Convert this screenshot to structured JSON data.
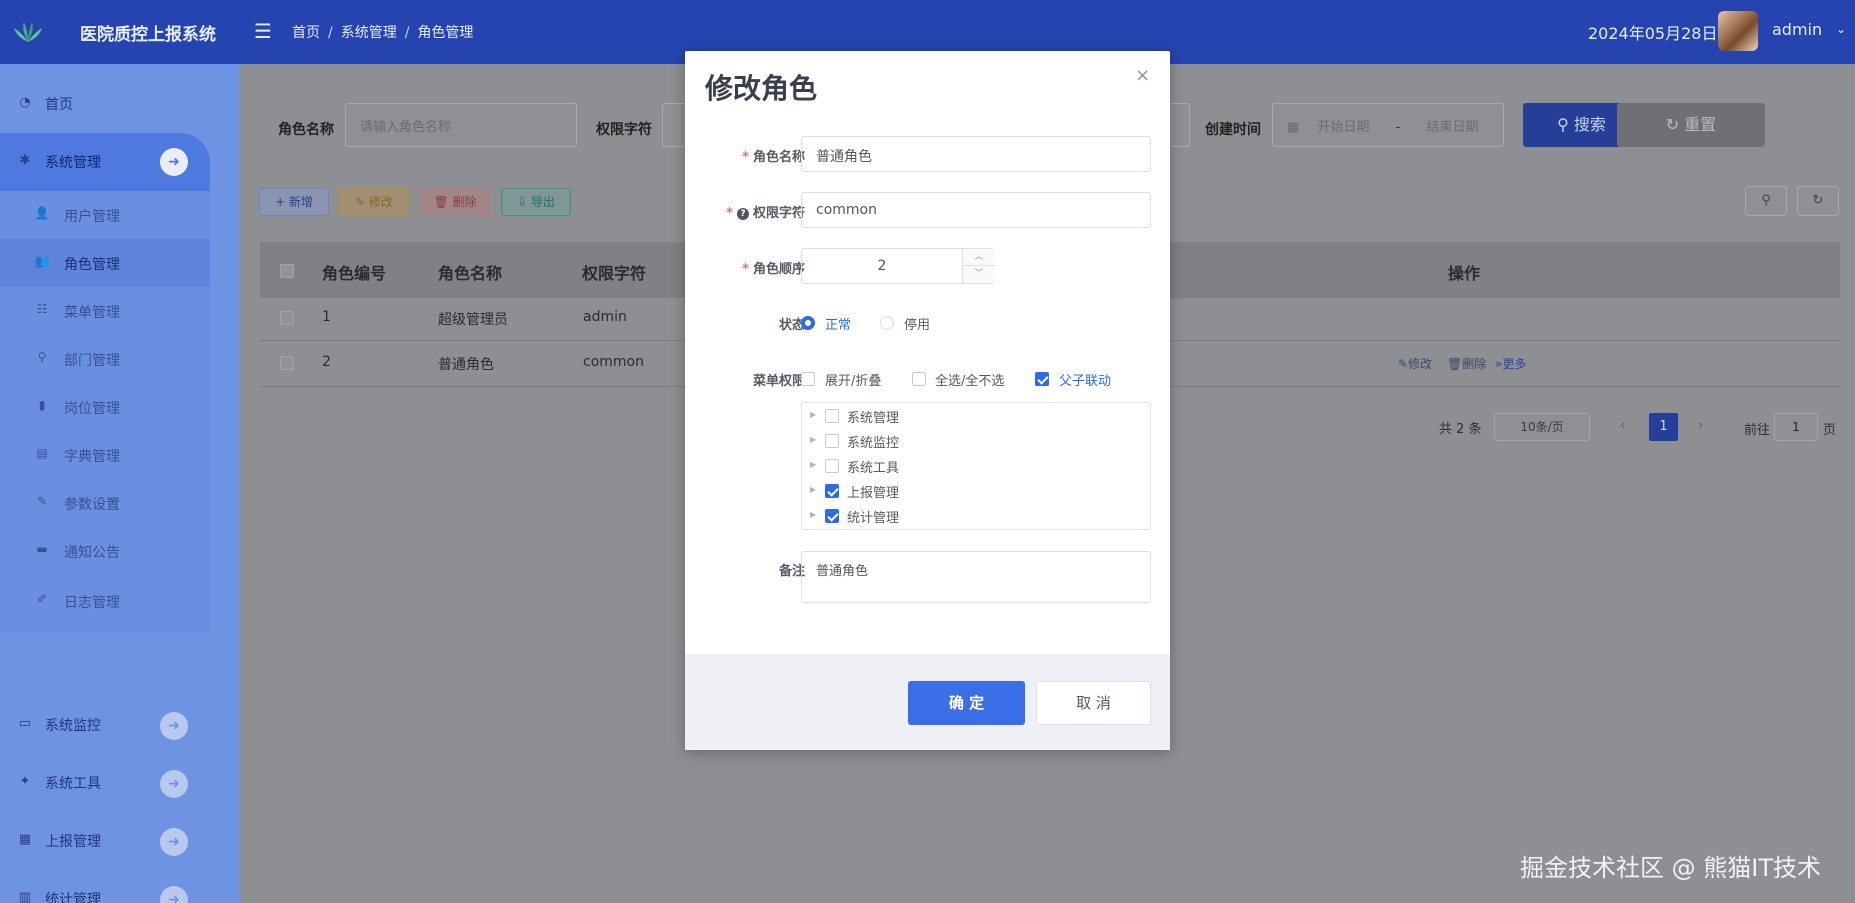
{
  "header": {
    "app_title": "医院质控上报系统",
    "breadcrumb": [
      "首页",
      "系统管理",
      "角色管理"
    ],
    "date": "2024年05月28日",
    "username": "admin"
  },
  "sidebar": {
    "items": [
      {
        "label": "首页"
      },
      {
        "label": "系统管理"
      },
      {
        "label": "系统监控"
      },
      {
        "label": "系统工具"
      },
      {
        "label": "上报管理"
      },
      {
        "label": "统计管理"
      }
    ],
    "submenu": [
      {
        "label": "用户管理"
      },
      {
        "label": "角色管理"
      },
      {
        "label": "菜单管理"
      },
      {
        "label": "部门管理"
      },
      {
        "label": "岗位管理"
      },
      {
        "label": "字典管理"
      },
      {
        "label": "参数设置"
      },
      {
        "label": "通知公告"
      },
      {
        "label": "日志管理"
      }
    ]
  },
  "search": {
    "role_name_label": "角色名称",
    "role_name_placeholder": "请输入角色名称",
    "perm_label": "权限字符",
    "created_label": "创建时间",
    "date_start": "开始日期",
    "date_sep": "-",
    "date_end": "结束日期",
    "search_btn": "搜索",
    "reset_btn": "重置"
  },
  "toolbar": {
    "add": "+ 新增",
    "edit": "✎ 修改",
    "delete": "🗑 删除",
    "export": "⇩ 导出"
  },
  "table": {
    "columns": [
      "角色编号",
      "角色名称",
      "权限字符",
      "操作"
    ],
    "rows": [
      {
        "id": "1",
        "name": "超级管理员",
        "perm": "admin"
      },
      {
        "id": "2",
        "name": "普通角色",
        "perm": "common",
        "ops": [
          "✎修改",
          "🗑删除",
          "»更多"
        ]
      }
    ]
  },
  "pager": {
    "total": "共 2 条",
    "size": "10条/页",
    "current": "1",
    "goto_label": "前往",
    "goto_value": "1",
    "page_unit": "页"
  },
  "modal": {
    "title": "修改角色",
    "role_name_label": "角色名称",
    "role_name_value": "普通角色",
    "perm_label": "权限字符",
    "perm_value": "common",
    "order_label": "角色顺序",
    "order_value": "2",
    "status_label": "状态",
    "status_normal": "正常",
    "status_disabled": "停用",
    "menu_perm_label": "菜单权限",
    "expand_label": "展开/折叠",
    "select_all_label": "全选/全不选",
    "linkage_label": "父子联动",
    "tree": [
      {
        "label": "系统管理",
        "checked": false
      },
      {
        "label": "系统监控",
        "checked": false
      },
      {
        "label": "系统工具",
        "checked": false
      },
      {
        "label": "上报管理",
        "checked": true
      },
      {
        "label": "统计管理",
        "checked": true
      }
    ],
    "remark_label": "备注",
    "remark_value": "普通角色",
    "ok_btn": "确 定",
    "cancel_btn": "取 消"
  },
  "watermark": "掘金技术社区 @ 熊猫IT技术",
  "colors": {
    "header_bg": "#2644b0",
    "primary": "#3a6fe8",
    "required": "#f56c6c"
  }
}
